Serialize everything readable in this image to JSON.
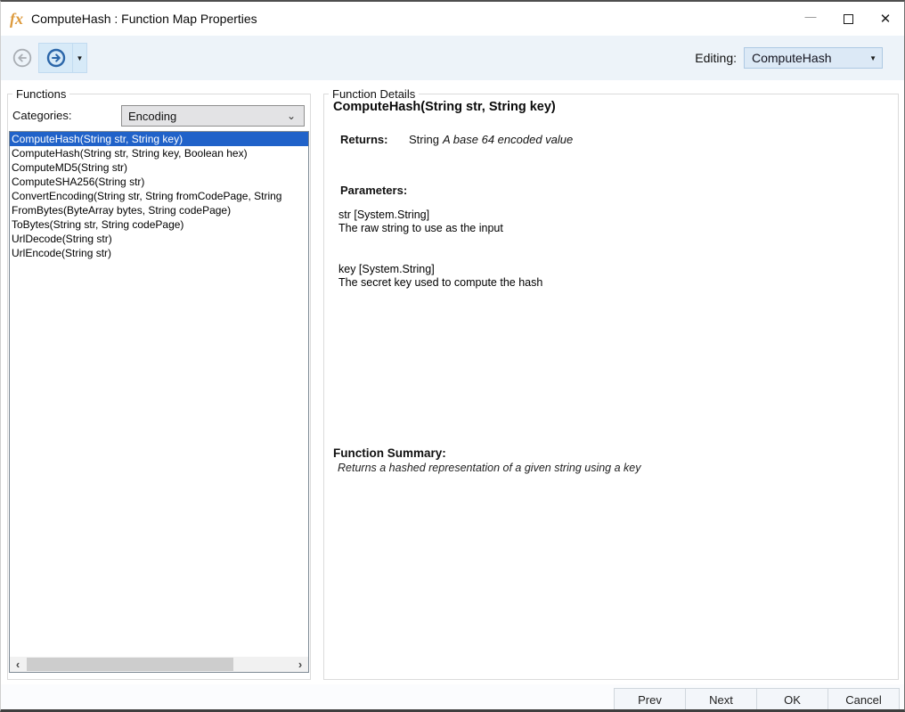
{
  "window": {
    "title": "ComputeHash : Function Map Properties"
  },
  "icons": {
    "app": "fx",
    "minimize": "—",
    "close": "✕",
    "chevron_down_small": "▼",
    "combo_chevron": "⌄",
    "scroll_left": "‹",
    "scroll_right": "›"
  },
  "toolbar": {
    "editing_label": "Editing:",
    "editing_value": "ComputeHash"
  },
  "functions_panel": {
    "title": "Functions",
    "categories_label": "Categories:",
    "categories_value": "Encoding",
    "selected_index": 0,
    "items": [
      "ComputeHash(String str, String key)",
      "ComputeHash(String str, String key, Boolean hex)",
      "ComputeMD5(String str)",
      "ComputeSHA256(String str)",
      "ConvertEncoding(String str, String fromCodePage, String",
      "FromBytes(ByteArray bytes, String codePage)",
      "ToBytes(String str, String codePage)",
      "UrlDecode(String str)",
      "UrlEncode(String str)"
    ]
  },
  "details_panel": {
    "title": "Function Details",
    "heading": "ComputeHash(String str, String key)",
    "returns_label": "Returns:",
    "returns_type": "String",
    "returns_desc": "A base 64 encoded value",
    "parameters_label": "Parameters:",
    "parameters": [
      {
        "name": "str [System.String]",
        "desc": "The raw string to use as the input"
      },
      {
        "name": "key [System.String]",
        "desc": "The secret key used to compute the hash"
      }
    ],
    "summary_label": "Function Summary:",
    "summary": "Returns a hashed representation of a given string using a key"
  },
  "footer": {
    "buttons": [
      "Prev",
      "Next",
      "OK",
      "Cancel"
    ]
  },
  "colors": {
    "selection_blue": "#2062C9",
    "toolbar_bg": "#EDF3F9",
    "nav_accent_blue": "#2B66A9",
    "app_icon_orange": "#DD9A3C"
  }
}
